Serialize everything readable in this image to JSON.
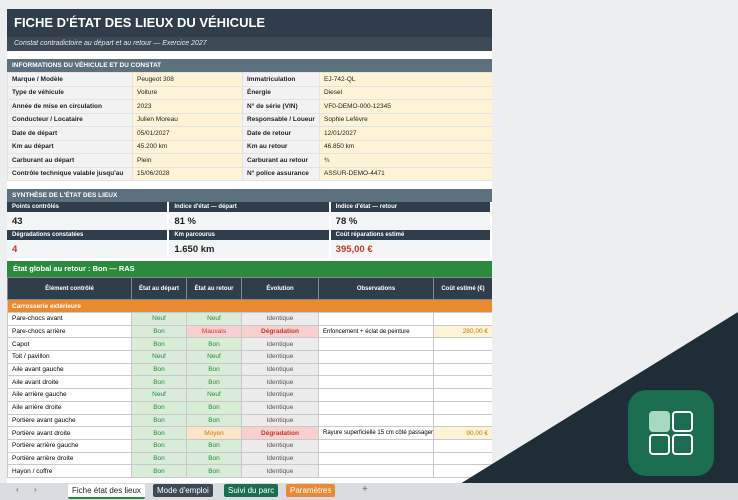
{
  "header": {
    "title": "FICHE D'ÉTAT DES LIEUX DU VÉHICULE",
    "subtitle": "Constat contradictoire au départ et au retour — Exercice 2027"
  },
  "info": {
    "section_title": "INFORMATIONS DU VÉHICULE ET DU CONSTAT",
    "rows": [
      {
        "l1": "Marque / Modèle",
        "v1": "Peugeot 308",
        "l2": "Immatriculation",
        "v2": "EJ-742-QL"
      },
      {
        "l1": "Type de véhicule",
        "v1": "Voiture",
        "l2": "Énergie",
        "v2": "Diesel"
      },
      {
        "l1": "Année de mise en circulation",
        "v1": "2023",
        "l2": "N° de série (VIN)",
        "v2": "VF0-DEMO-000-12345"
      },
      {
        "l1": "Conducteur / Locataire",
        "v1": "Julien Moreau",
        "l2": "Responsable / Loueur",
        "v2": "Sophie Lefèvre"
      },
      {
        "l1": "Date de départ",
        "v1": "05/01/2027",
        "l2": "Date de retour",
        "v2": "12/01/2027"
      },
      {
        "l1": "Km au départ",
        "v1": "45.200 km",
        "l2": "Km au retour",
        "v2": "46.850 km"
      },
      {
        "l1": "Carburant au départ",
        "v1": "Plein",
        "l2": "Carburant au retour",
        "v2": "¾"
      },
      {
        "l1": "Contrôle technique valable jusqu'au",
        "v1": "15/06/2028",
        "l2": "N° police assurance",
        "v2": "ASSUR-DEMO-4471"
      }
    ]
  },
  "synthese": {
    "section_title": "SYNTHÈSE DE L'ÉTAT DES LIEUX",
    "row1_labels": [
      "Points contrôlés",
      "Indice d'état — départ",
      "Indice d'état — retour"
    ],
    "row1_values": [
      "43",
      "81 %",
      "78 %"
    ],
    "row2_labels": [
      "Dégradations constatées",
      "Km parcourus",
      "Coût réparations estimé"
    ],
    "row2_values": [
      "4",
      "1.650 km",
      "395,00 €"
    ]
  },
  "global_status": "État global au retour : Bon — RAS",
  "grid": {
    "headers": [
      "Élément contrôlé",
      "État au départ",
      "État au retour",
      "Évolution",
      "Observations",
      "Coût estimé (€)"
    ],
    "category": "Carrosserie extérieure",
    "rows": [
      {
        "el": "Pare-chocs avant",
        "dep": "Neuf",
        "ret": "Neuf",
        "evo": "Identique",
        "obs": "",
        "cost": ""
      },
      {
        "el": "Pare-chocs arrière",
        "dep": "Bon",
        "ret": "Mauvais",
        "evo": "Dégradation",
        "obs": "Enfoncement + éclat de peinture",
        "cost": "280,00 €"
      },
      {
        "el": "Capot",
        "dep": "Bon",
        "ret": "Bon",
        "evo": "Identique",
        "obs": "",
        "cost": ""
      },
      {
        "el": "Toit / pavillon",
        "dep": "Neuf",
        "ret": "Neuf",
        "evo": "Identique",
        "obs": "",
        "cost": ""
      },
      {
        "el": "Aile avant gauche",
        "dep": "Bon",
        "ret": "Bon",
        "evo": "Identique",
        "obs": "",
        "cost": ""
      },
      {
        "el": "Aile avant droite",
        "dep": "Bon",
        "ret": "Bon",
        "evo": "Identique",
        "obs": "",
        "cost": ""
      },
      {
        "el": "Aile arrière gauche",
        "dep": "Neuf",
        "ret": "Neuf",
        "evo": "Identique",
        "obs": "",
        "cost": ""
      },
      {
        "el": "Aile arrière droite",
        "dep": "Bon",
        "ret": "Bon",
        "evo": "Identique",
        "obs": "",
        "cost": ""
      },
      {
        "el": "Portière avant gauche",
        "dep": "Bon",
        "ret": "Bon",
        "evo": "Identique",
        "obs": "",
        "cost": ""
      },
      {
        "el": "Portière avant droite",
        "dep": "Bon",
        "ret": "Moyen",
        "evo": "Dégradation",
        "obs": "Rayure superficielle 15 cm côté passager",
        "cost": "90,00 €"
      },
      {
        "el": "Portière arrière gauche",
        "dep": "Bon",
        "ret": "Bon",
        "evo": "Identique",
        "obs": "",
        "cost": ""
      },
      {
        "el": "Portière arrière droite",
        "dep": "Bon",
        "ret": "Bon",
        "evo": "Identique",
        "obs": "",
        "cost": ""
      },
      {
        "el": "Hayon / coffre",
        "dep": "Bon",
        "ret": "Bon",
        "evo": "Identique",
        "obs": "",
        "cost": ""
      }
    ]
  },
  "tabs": [
    "Fiche état des lieux",
    "Mode d'emploi",
    "Suivi du parc",
    "Paramètres"
  ],
  "add_tab": "+",
  "colors": {
    "dark": "#2f3e4a",
    "green": "#2b8a3e",
    "orange": "#ea8a30",
    "red": "#c0392b",
    "app_icon": "#1a6e4f"
  }
}
